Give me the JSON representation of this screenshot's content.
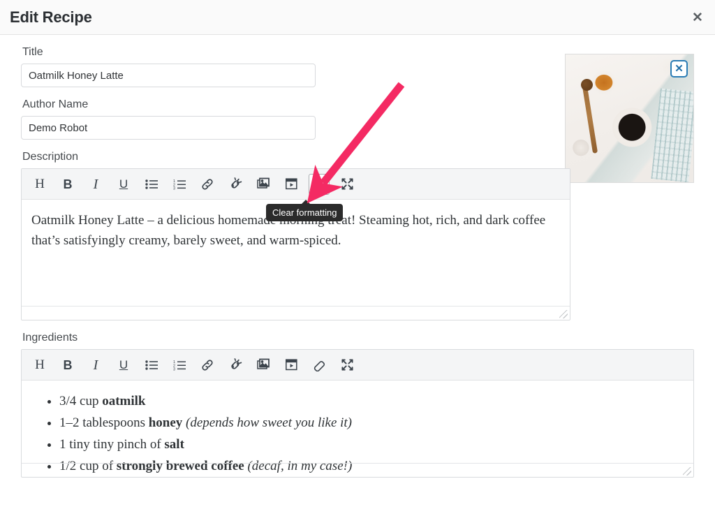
{
  "header": {
    "title": "Edit Recipe",
    "close_label": "✕"
  },
  "form": {
    "title_label": "Title",
    "title_value": "Oatmilk Honey Latte",
    "title_placeholder": "Title",
    "author_label": "Author Name",
    "author_value": "Demo Robot",
    "author_placeholder": "Author Name",
    "description_label": "Description",
    "ingredients_label": "Ingredients"
  },
  "thumbnail": {
    "remove_label": "✕",
    "alt": "coffee-flatlay-photo"
  },
  "toolbar": {
    "buttons": [
      {
        "name": "heading-icon",
        "label": "H",
        "tooltip": "Heading",
        "active": false
      },
      {
        "name": "bold-icon",
        "label": "B",
        "tooltip": "Bold",
        "active": false
      },
      {
        "name": "italic-icon",
        "label": "I",
        "tooltip": "Italic",
        "active": false
      },
      {
        "name": "underline-icon",
        "label": "U",
        "tooltip": "Underline",
        "active": false
      },
      {
        "name": "bulleted-list-icon",
        "label": "",
        "tooltip": "Bulleted list",
        "active": false
      },
      {
        "name": "numbered-list-icon",
        "label": "",
        "tooltip": "Numbered list",
        "active": false
      },
      {
        "name": "link-icon",
        "label": "",
        "tooltip": "Insert link",
        "active": false
      },
      {
        "name": "unlink-icon",
        "label": "",
        "tooltip": "Remove link",
        "active": false
      },
      {
        "name": "image-icon",
        "label": "",
        "tooltip": "Insert image",
        "active": false
      },
      {
        "name": "video-icon",
        "label": "",
        "tooltip": "Insert video",
        "active": false
      },
      {
        "name": "eraser-icon",
        "label": "",
        "tooltip": "Clear formatting",
        "active": true
      },
      {
        "name": "fullscreen-icon",
        "label": "",
        "tooltip": "Fullscreen",
        "active": false
      }
    ]
  },
  "tooltip": {
    "text": "Clear formatting"
  },
  "description": {
    "paragraph": "Oatmilk Honey Latte – a delicious homemade morning treat! Steaming hot, rich, and dark coffee that’s satisfyingly creamy, barely sweet, and warm-spiced."
  },
  "ingredients": {
    "items": [
      {
        "qty": "3/4 cup ",
        "bold": "oatmilk",
        "after": "",
        "italic": ""
      },
      {
        "qty": "1–2 tablespoons ",
        "bold": "honey",
        "after": " ",
        "italic": "(depends how sweet you like it)"
      },
      {
        "qty": "1 tiny tiny pinch of ",
        "bold": "salt",
        "after": "",
        "italic": ""
      },
      {
        "qty": "1/2 cup of ",
        "bold": "strongly brewed coffee",
        "after": " ",
        "italic": "(decaf, in my case!)"
      }
    ]
  },
  "annotation": {
    "arrow_color": "#F42A63",
    "target": "eraser-icon"
  }
}
